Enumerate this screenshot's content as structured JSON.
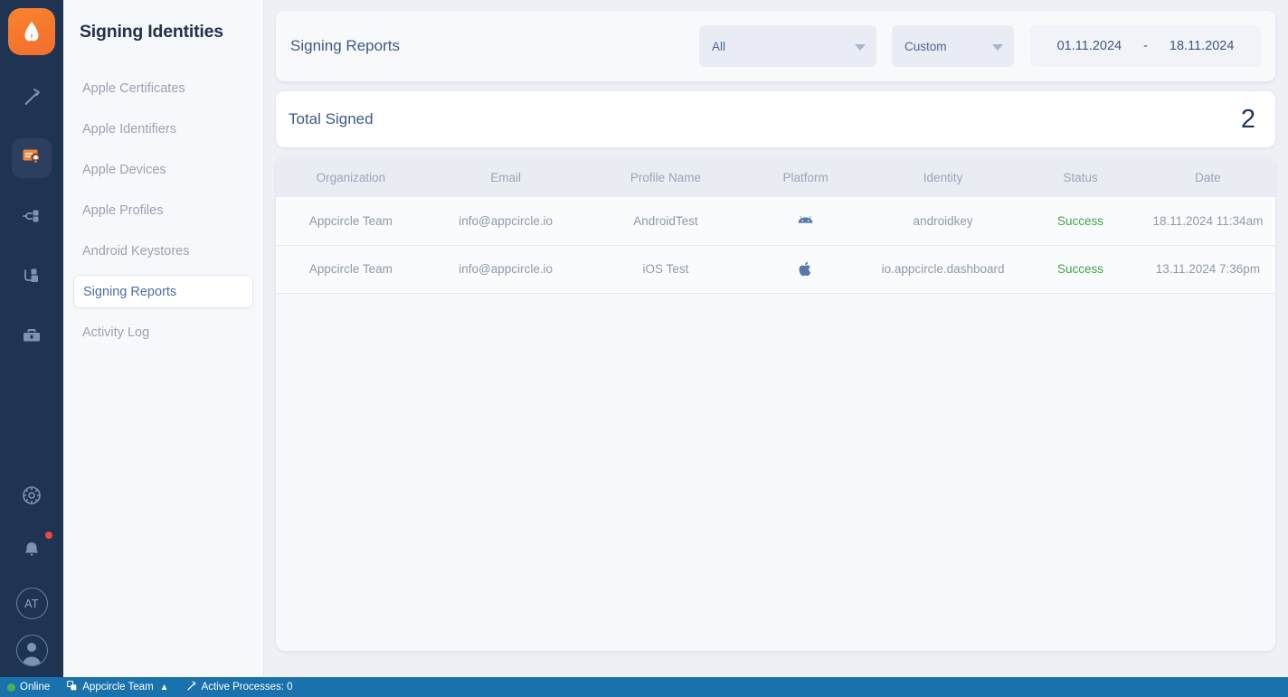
{
  "brand": {
    "logo_icon": "appcircle-logo-icon",
    "accent": "#f26d2e",
    "rail_bg": "#1f3352",
    "statusbar_bg": "#1a72ad",
    "success_color": "#3fa44b"
  },
  "rail": {
    "items": [
      {
        "icon": "hammer-build-icon",
        "active": false
      },
      {
        "icon": "certificate-signing-icon",
        "active": true
      },
      {
        "icon": "distribute-branch-icon",
        "active": false
      },
      {
        "icon": "store-submit-icon",
        "active": false
      },
      {
        "icon": "briefcase-enterprise-icon",
        "active": false
      }
    ],
    "bottom": [
      {
        "icon": "settings-gear-icon"
      },
      {
        "icon": "notifications-bell-icon",
        "badge": true
      },
      {
        "icon": "organization-avatar",
        "label": "AT"
      },
      {
        "icon": "user-profile-avatar"
      }
    ]
  },
  "sidebar": {
    "title": "Signing Identities",
    "items": [
      {
        "label": "Apple Certificates",
        "active": false
      },
      {
        "label": "Apple Identifiers",
        "active": false
      },
      {
        "label": "Apple Devices",
        "active": false
      },
      {
        "label": "Apple Profiles",
        "active": false
      },
      {
        "label": "Android Keystores",
        "active": false
      },
      {
        "label": "Signing Reports",
        "active": true
      },
      {
        "label": "Activity Log",
        "active": false
      }
    ]
  },
  "header": {
    "title": "Signing Reports",
    "filter_all": {
      "value": "All",
      "icon": "chevron-down-icon"
    },
    "filter_range": {
      "value": "Custom",
      "icon": "chevron-down-icon"
    },
    "date_from": "01.11.2024",
    "date_separator": "-",
    "date_to": "18.11.2024"
  },
  "total": {
    "label": "Total Signed",
    "value": "2"
  },
  "table": {
    "columns": [
      "Organization",
      "Email",
      "Profile Name",
      "Platform",
      "Identity",
      "Status",
      "Date"
    ],
    "rows": [
      {
        "organization": "Appcircle Team",
        "email": "info@appcircle.io",
        "profile_name": "AndroidTest",
        "platform_icon": "android-icon",
        "identity": "androidkey",
        "status": "Success",
        "date": "18.11.2024 11:34am"
      },
      {
        "organization": "Appcircle Team",
        "email": "info@appcircle.io",
        "profile_name": "iOS Test",
        "platform_icon": "apple-icon",
        "identity": "io.appcircle.dashboard",
        "status": "Success",
        "date": "13.11.2024 7:36pm"
      }
    ]
  },
  "statusbar": {
    "online": "Online",
    "online_icon": "green-dot-icon",
    "org_icon": "organization-switch-icon",
    "org": "Appcircle Team",
    "org_chevron": "chevron-up-icon",
    "processes_icon": "hammer-build-icon",
    "processes": "Active Processes: 0"
  }
}
